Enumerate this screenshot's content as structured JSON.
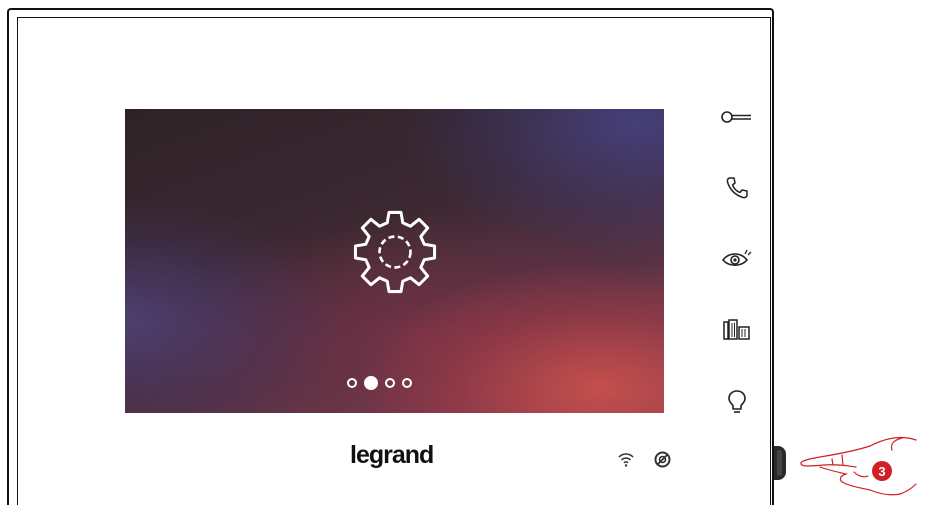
{
  "device": {
    "brand_logo": "legrand",
    "accent_color": "#d01f26",
    "screen": {
      "icon": "gear-icon",
      "pagination": {
        "total": 4,
        "active_index": 1
      }
    },
    "side_buttons": [
      {
        "name": "door-lock-key-button",
        "icon": "key-icon"
      },
      {
        "name": "call-answer-button",
        "icon": "phone-handset-icon"
      },
      {
        "name": "camera-view-button",
        "icon": "eye-icon"
      },
      {
        "name": "gate-open-button",
        "icon": "gate-icon"
      },
      {
        "name": "light-button",
        "icon": "light-bulb-icon"
      }
    ],
    "status_icons": [
      "wifi-icon",
      "do-not-disturb-icon"
    ]
  },
  "annotation": {
    "step_number": "3",
    "badge_color": "#d01f26"
  }
}
